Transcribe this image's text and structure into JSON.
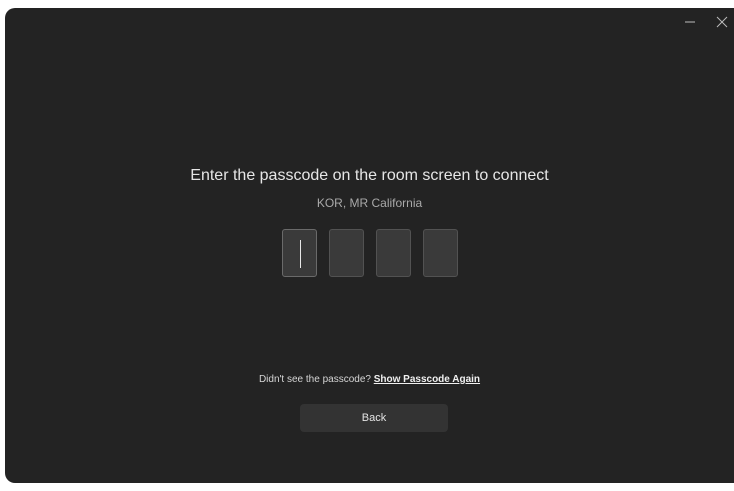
{
  "window": {
    "minimize_icon": "minimize-icon",
    "close_icon": "close-icon"
  },
  "connect": {
    "title": "Enter the passcode on the room screen to connect",
    "room_name": "KOR, MR California",
    "passcode_boxes": [
      "",
      "",
      "",
      ""
    ],
    "hint_text": "Didn't see the passcode? ",
    "show_again_link": "Show Passcode Again",
    "back_label": "Back"
  },
  "colors": {
    "background": "#232323",
    "box_fill": "#3a3a3a",
    "button_fill": "#333333"
  }
}
